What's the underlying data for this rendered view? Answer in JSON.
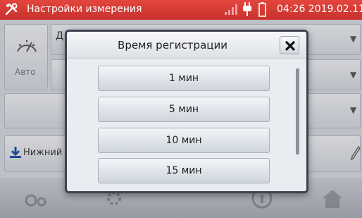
{
  "header": {
    "title": "Настройки измерения",
    "clock": "04:26 2019.02.11"
  },
  "background": {
    "auto_label": "Авто",
    "top_field_label": "Д",
    "lower_label": "Нижний"
  },
  "dialog": {
    "title": "Время регистрации",
    "options": [
      "1 мин",
      "5 мин",
      "10 мин",
      "15 мин"
    ]
  },
  "colors": {
    "titlebar": "#d43c35",
    "dialog_border": "#3d4350"
  }
}
